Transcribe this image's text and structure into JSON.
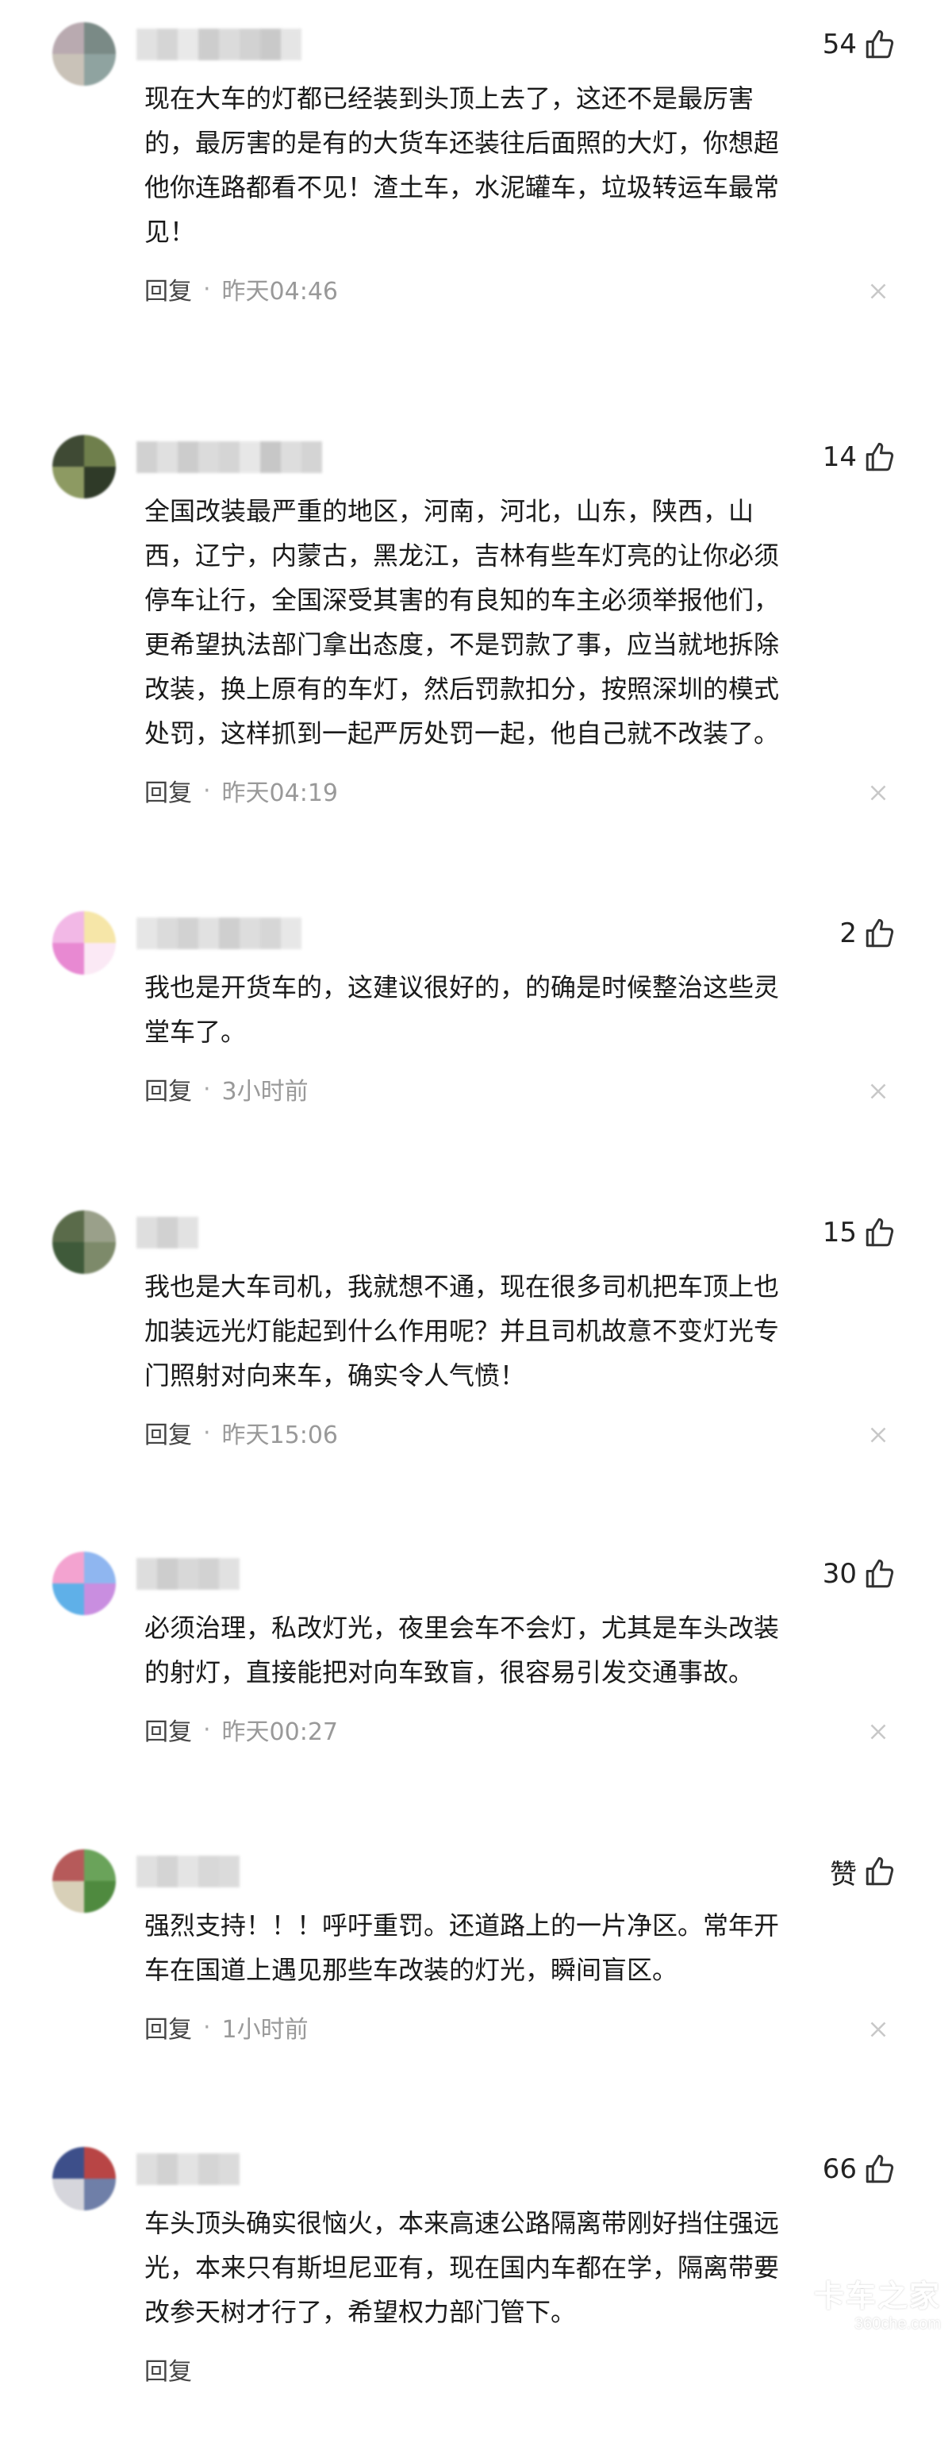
{
  "comments": [
    {
      "likes": "54",
      "text": "现在大车的灯都已经装到头顶上去了，这还不是最厉害\n的，最厉害的是有的大货车还装往后面照的大灯，你想超\n他你连路都看不见！渣土车，水泥罐车，垃圾转运车最常\n见！",
      "reply": "回复",
      "time": "昨天04:46",
      "avatar_colors": [
        "#b9aab0",
        "#7a8a86",
        "#c9c2b8",
        "#8fa3a0"
      ],
      "name_colors": [
        "#d8d8d8",
        "#c8c8c8",
        "#e2e2e2",
        "#bdbdbd",
        "#d0d0d0",
        "#c4c4c4",
        "#b8b8b8",
        "#dddddd"
      ]
    },
    {
      "likes": "14",
      "text": "全国改装最严重的地区，河南，河北，山东，陕西，山\n西，辽宁，内蒙古，黑龙江，吉林有些车灯亮的让你必须\n停车让行，全国深受其害的有良知的车主必须举报他们，\n更希望执法部门拿出态度，不是罚款了事，应当就地拆除\n改装，换上原有的车灯，然后罚款扣分，按照深圳的模式\n处罚，这样抓到一起严厉处罚一起，他自己就不改装了。",
      "reply": "回复",
      "time": "昨天04:19",
      "avatar_colors": [
        "#3f4a34",
        "#6f7f4c",
        "#8d9a62",
        "#2f3a28"
      ],
      "name_colors": [
        "#c2c2c2",
        "#d6d6d6",
        "#bcbcbc",
        "#cfcfcf",
        "#c8c8c8",
        "#e0e0e0",
        "#b5b5b5",
        "#d2d2d2",
        "#c6c6c6"
      ]
    },
    {
      "likes": "2",
      "text": "我也是开货车的，这建议很好的，的确是时候整治这些灵\n堂车了。",
      "reply": "回复",
      "time": "3小时前",
      "avatar_colors": [
        "#f2b8e6",
        "#f6e6a8",
        "#e889d2",
        "#fbe9f5"
      ],
      "name_colors": [
        "#dedede",
        "#cfcfcf",
        "#c4c4c4",
        "#d8d8d8",
        "#bfbfbf",
        "#d2d2d2",
        "#c9c9c9",
        "#e0e0e0"
      ]
    },
    {
      "likes": "15",
      "text": "我也是大车司机，我就想不通，现在很多司机把车顶上也\n加装远光灯能起到什么作用呢？并且司机故意不变灯光专\n门照射对向来车，确实令人气愤！",
      "reply": "回复",
      "time": "昨天15:06",
      "avatar_colors": [
        "#5a6b4a",
        "#9aa08a",
        "#3f5a3a",
        "#7d8a6a"
      ],
      "name_colors": [
        "#d4d4d4",
        "#c2c2c2",
        "#d9d9d9"
      ]
    },
    {
      "likes": "30",
      "text": "必须治理，私改灯光，夜里会车不会灯，尤其是车头改装\n的射灯，直接能把对向车致盲，很容易引发交通事故。",
      "reply": "回复",
      "time": "昨天00:27",
      "avatar_colors": [
        "#f3a3d0",
        "#8fb6f0",
        "#5fb0e8",
        "#c98ee0"
      ],
      "name_colors": [
        "#d2d2d2",
        "#bdbdbd",
        "#cccccc",
        "#c4c4c4",
        "#d8d8d8"
      ]
    },
    {
      "likes": "赞",
      "text": "强烈支持！！！呼吁重罚。还道路上的一片净区。常年开\n车在国道上遇见那些车改装的灯光，瞬间盲区。",
      "reply": "回复",
      "time": "1小时前",
      "avatar_colors": [
        "#b65a5a",
        "#6aa35a",
        "#d8d0b8",
        "#4f8a3f"
      ],
      "name_colors": [
        "#d6d6d6",
        "#c6c6c6",
        "#dcdcdc",
        "#cbcbcb",
        "#d0d0d0"
      ]
    },
    {
      "likes": "66",
      "text": "车头顶头确实很恼火，本来高速公路隔离带刚好挡住强远\n光，本来只有斯坦尼亚有，现在国内车都在学，隔离带要\n改参天树才行了，希望权力部门管下。",
      "reply": "回复",
      "time": "",
      "avatar_colors": [
        "#3d4f8a",
        "#b84545",
        "#d6d6dc",
        "#6f7fa8"
      ],
      "name_colors": [
        "#d4d4d4",
        "#c4c4c4",
        "#dadada",
        "#c8c8c8",
        "#cfcfcf"
      ]
    }
  ],
  "watermark": {
    "line1": "卡车之家",
    "line2": "360che.com"
  }
}
